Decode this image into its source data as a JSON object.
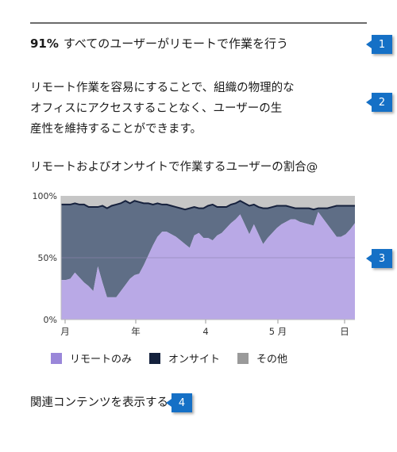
{
  "headline": {
    "stat": "91%",
    "text": "すべてのユーザーがリモートで作業を行う"
  },
  "description": {
    "line1": "リモート作業を容易にすることで、組織の物理的な",
    "line2": "オフィスにアクセスすることなく、ユーザーの生",
    "line3": "産性を維持することができます。"
  },
  "related_link": "関連コンテンツを表示する",
  "callouts": [
    "1",
    "2",
    "3",
    "4"
  ],
  "colors": {
    "remote": "#b9a9e6",
    "onsite": "#5f6e86",
    "other": "#c6c6c6",
    "line": "#16213d",
    "callout": "#1570c6",
    "legend_remote": "#9a87d9",
    "legend_onsite": "#14213d",
    "legend_other": "#9a9a9a"
  },
  "chart_data": {
    "type": "area",
    "title": "リモートおよびオンサイトで作業するユーザーの割合@",
    "y_ticks": [
      "100%",
      "50%",
      "0%"
    ],
    "ylim": [
      0,
      100
    ],
    "x_tick_labels": [
      "月",
      "年",
      "4",
      "5 月",
      "日"
    ],
    "stacked": true,
    "series": [
      {
        "name": "リモートのみ",
        "values": [
          32,
          32,
          33,
          38,
          34,
          30,
          27,
          23,
          43,
          30,
          18,
          18,
          18,
          23,
          28,
          33,
          36,
          37,
          44,
          52,
          60,
          67,
          71,
          71,
          69,
          67,
          64,
          61,
          58,
          68,
          70,
          66,
          66,
          64,
          68,
          70,
          74,
          78,
          81,
          85,
          77,
          69,
          77,
          69,
          61,
          66,
          70,
          74,
          77,
          79,
          81,
          81,
          79,
          78,
          77,
          76,
          87,
          82,
          77,
          72,
          67,
          67,
          69,
          73,
          78
        ],
        "_note": ""
      },
      {
        "name": "オンサイト",
        "values": [
          61,
          61,
          60,
          56,
          59,
          63,
          64,
          68,
          48,
          62,
          72,
          74,
          75,
          71,
          68,
          61,
          60,
          58,
          50,
          42,
          33,
          27,
          22,
          22,
          23,
          24,
          26,
          28,
          32,
          23,
          20,
          24,
          26,
          29,
          23,
          21,
          17,
          15,
          13,
          11,
          17,
          23,
          16,
          22,
          29,
          24,
          21,
          18,
          15,
          13,
          10,
          9,
          11,
          12,
          13,
          13,
          3,
          8,
          13,
          19,
          25,
          25,
          23,
          19,
          14
        ]
      },
      {
        "name": "その他",
        "values": [
          7,
          7,
          7,
          6,
          7,
          7,
          9,
          9,
          9,
          8,
          10,
          8,
          7,
          6,
          4,
          6,
          4,
          5,
          6,
          6,
          7,
          6,
          7,
          7,
          8,
          9,
          10,
          11,
          10,
          9,
          10,
          10,
          8,
          7,
          9,
          9,
          9,
          7,
          6,
          4,
          6,
          8,
          7,
          9,
          10,
          10,
          9,
          8,
          8,
          8,
          9,
          10,
          10,
          10,
          10,
          11,
          10,
          10,
          10,
          9,
          8,
          8,
          8,
          8,
          8
        ]
      }
    ]
  }
}
